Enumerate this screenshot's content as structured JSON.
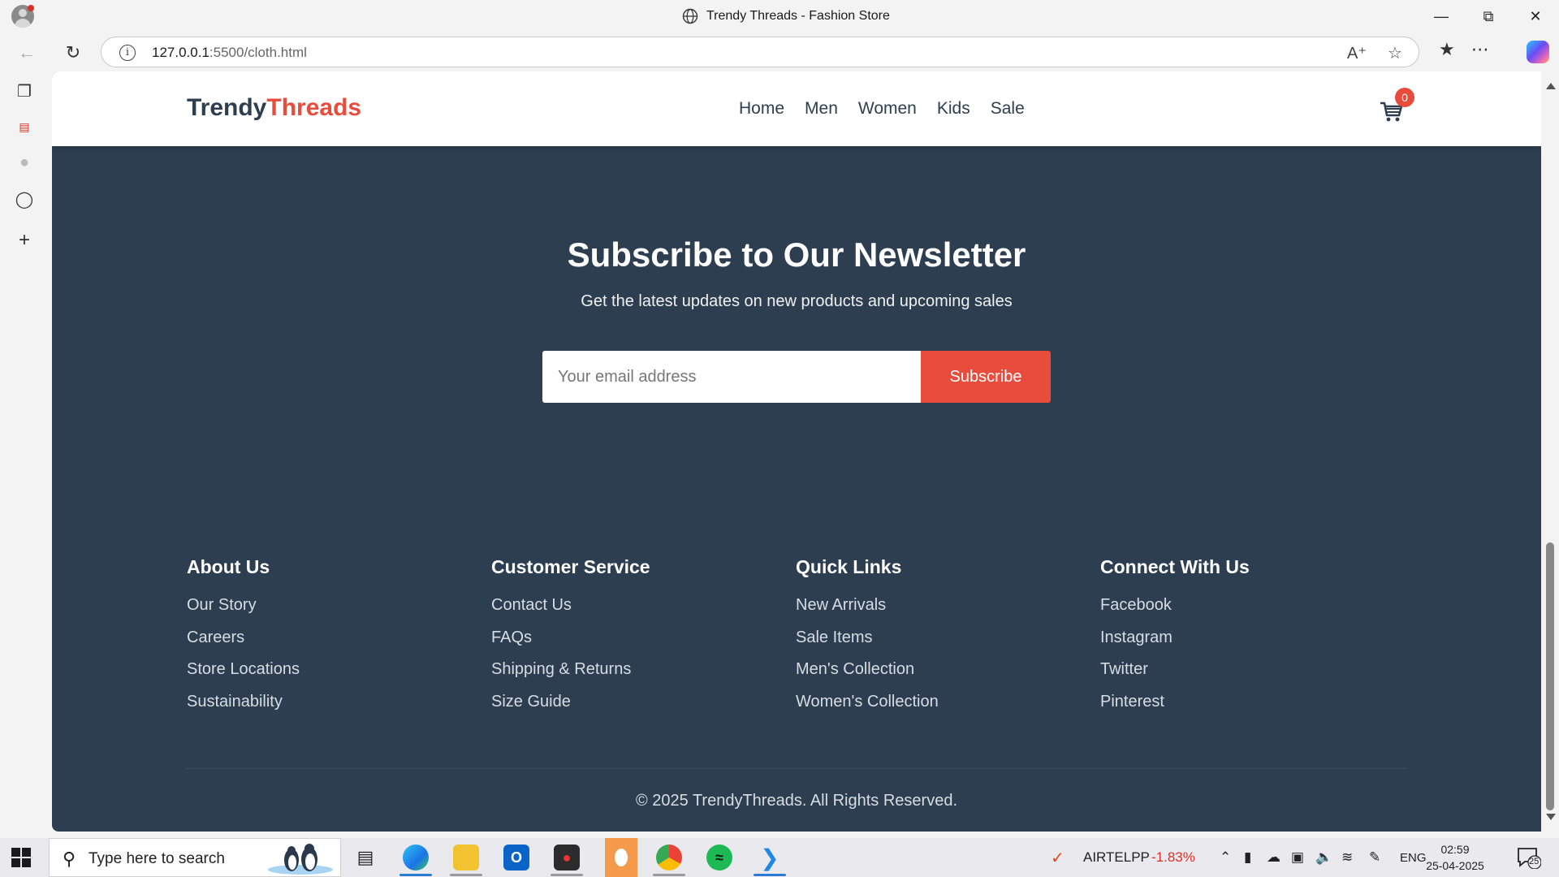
{
  "browser": {
    "tab_title": "Trendy Threads - Fashion Store",
    "url_host": "127.0.0.1",
    "url_rest": ":5500/cloth.html"
  },
  "site": {
    "logo_part1": "Trendy",
    "logo_part2": "Threads",
    "nav": [
      "Home",
      "Men",
      "Women",
      "Kids",
      "Sale"
    ],
    "cart_count": "0",
    "accent_color": "#e74c3c",
    "dark_color": "#2c3e50"
  },
  "newsletter": {
    "title": "Subscribe to Our Newsletter",
    "subtitle": "Get the latest updates on new products and upcoming sales",
    "email_placeholder": "Your email address",
    "button_label": "Subscribe"
  },
  "footer": {
    "columns": [
      {
        "heading": "About Us",
        "links": [
          "Our Story",
          "Careers",
          "Store Locations",
          "Sustainability"
        ]
      },
      {
        "heading": "Customer Service",
        "links": [
          "Contact Us",
          "FAQs",
          "Shipping & Returns",
          "Size Guide"
        ]
      },
      {
        "heading": "Quick Links",
        "links": [
          "New Arrivals",
          "Sale Items",
          "Men's Collection",
          "Women's Collection"
        ]
      },
      {
        "heading": "Connect With Us",
        "links": [
          "Facebook",
          "Instagram",
          "Twitter",
          "Pinterest"
        ]
      }
    ],
    "copyright": "© 2025 TrendyThreads. All Rights Reserved."
  },
  "taskbar": {
    "search_placeholder": "Type here to search",
    "stock_name": "AIRTELPP",
    "stock_change": "-1.83%",
    "language": "ENG",
    "time": "02:59",
    "date": "25-04-2025",
    "notification_count": "25"
  }
}
